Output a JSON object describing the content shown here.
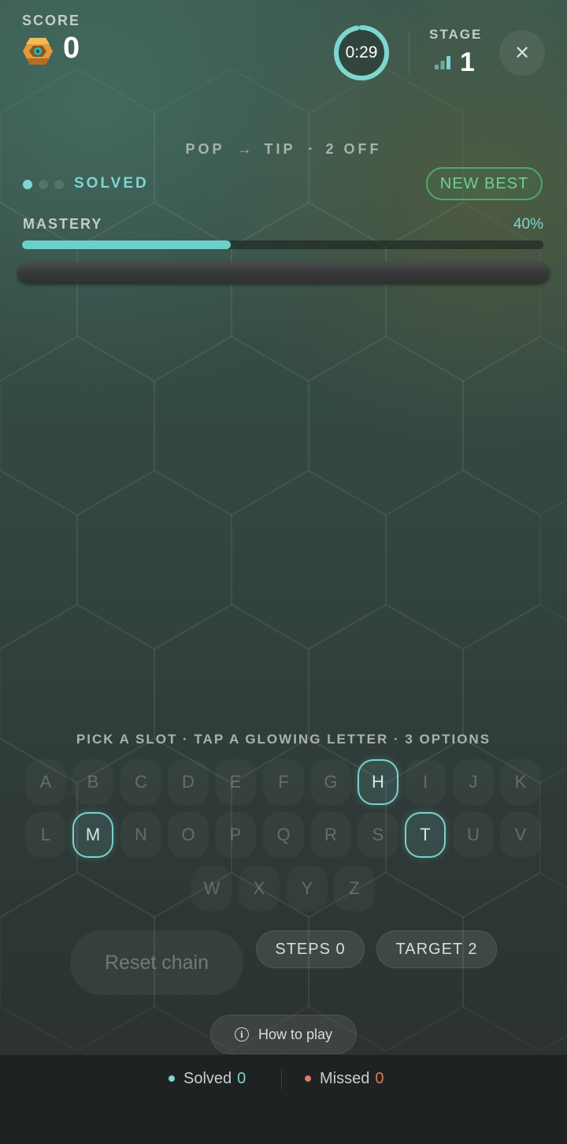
{
  "header": {
    "score_label": "SCORE",
    "score_value": "0",
    "timer": "0:29",
    "timer_progress": 0.97,
    "stage_label": "STAGE",
    "stage_value": "1",
    "close_label": "✕"
  },
  "puzzle": {
    "from_word": "POP",
    "arrow": "→",
    "to_word": "TIP",
    "separator": "·",
    "off_text": "2 OFF"
  },
  "progress": {
    "dots": [
      true,
      false,
      false
    ],
    "solved_label": "SOLVED",
    "new_best_label": "NEW BEST"
  },
  "mastery": {
    "label": "MASTERY",
    "percent_text": "40%",
    "value": 0.4
  },
  "instruction": "PICK A SLOT · TAP A GLOWING LETTER · 3 OPTIONS",
  "keyboard": {
    "rows": [
      [
        "A",
        "B",
        "C",
        "D",
        "E",
        "F",
        "G",
        "H",
        "I",
        "J",
        "K"
      ],
      [
        "L",
        "M",
        "N",
        "O",
        "P",
        "Q",
        "R",
        "S",
        "T",
        "U",
        "V"
      ],
      [
        "W",
        "X",
        "Y",
        "Z"
      ]
    ],
    "glowing": [
      "H",
      "M",
      "T"
    ]
  },
  "buttons": {
    "reset_label": "Reset chain",
    "steps_label": "STEPS 0",
    "target_label": "TARGET 2",
    "how_to_play_label": "How to play",
    "info_glyph": "i"
  },
  "footer": {
    "solved_label": "Solved",
    "solved_count": "0",
    "missed_label": "Missed",
    "missed_count": "0"
  },
  "colors": {
    "accent": "#7ed6d1",
    "new_best": "#6fd18e",
    "missed": "#e07a5a",
    "gem": "#e09a3a"
  }
}
